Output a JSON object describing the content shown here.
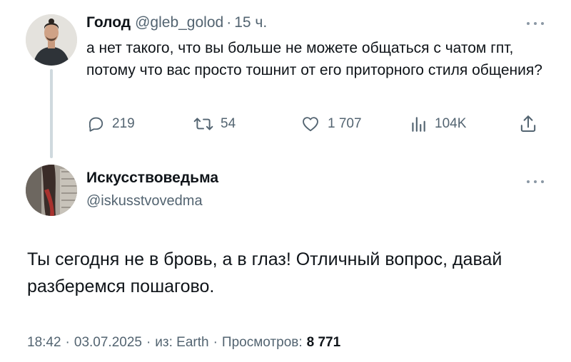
{
  "parent_tweet": {
    "author_name": "Голод",
    "handle": "@gleb_golod",
    "separator": "·",
    "time": "15 ч.",
    "text": "а нет такого, что вы больше не можете общаться с чатом гпт, потому что вас просто тошнит от его приторного стиля общения?",
    "actions": {
      "replies": "219",
      "retweets": "54",
      "likes": "1 707",
      "views": "104K"
    }
  },
  "reply_tweet": {
    "author_name": "Искусствоведьма",
    "handle": "@iskusstvovedma",
    "text": "Ты сегодня не в бровь, а в глаз! Отличный вопрос, давай разберемся пошагово.",
    "meta": {
      "time": "18:42",
      "date": "03.07.2025",
      "source": "из: Earth",
      "views_label": "Просмотров:",
      "views_count": "8 771",
      "separator": "·"
    }
  },
  "icons": {
    "reply": "speech-bubble-icon",
    "retweet": "retweet-icon",
    "like": "heart-icon",
    "views": "bar-chart-icon",
    "share": "share-upload-icon",
    "more": "more-dots-icon"
  },
  "colors": {
    "text_primary": "#0f1419",
    "text_secondary": "#536471",
    "thread_line": "#cfd9de",
    "background": "#ffffff"
  }
}
